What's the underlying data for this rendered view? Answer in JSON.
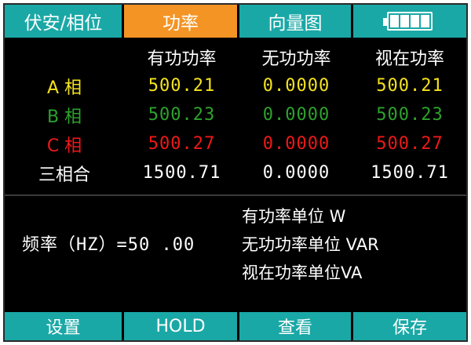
{
  "tabs": [
    {
      "label": "伏安/相位"
    },
    {
      "label": "功率"
    },
    {
      "label": "向量图"
    }
  ],
  "colors": {
    "tab_bg": "#1aa8a6",
    "tab_active_bg": "#f39424",
    "phase_a": "#f5e31c",
    "phase_b": "#2da22d",
    "phase_c": "#f01818",
    "total": "#ffffff"
  },
  "icons": {
    "battery": "battery-full-icon"
  },
  "table": {
    "headers": [
      "有功功率",
      "无功功率",
      "视在功率"
    ],
    "rows": [
      {
        "label": "A 相",
        "active": "500.21",
        "reactive": "0.0000",
        "apparent": "500.21"
      },
      {
        "label": "B 相",
        "active": "500.23",
        "reactive": "0.0000",
        "apparent": "500.23"
      },
      {
        "label": "C 相",
        "active": "500.27",
        "reactive": "0.0000",
        "apparent": "500.27"
      },
      {
        "label": "三相合",
        "active": "1500.71",
        "reactive": "0.0000",
        "apparent": "1500.71"
      }
    ]
  },
  "frequency": {
    "text": "频率（HZ）=50 .00"
  },
  "units": [
    "有功率单位 W",
    "无功功率单位 VAR",
    "视在功率单位VA"
  ],
  "buttons": [
    {
      "label": "设置"
    },
    {
      "label": "HOLD"
    },
    {
      "label": "查看"
    },
    {
      "label": "保存"
    }
  ]
}
